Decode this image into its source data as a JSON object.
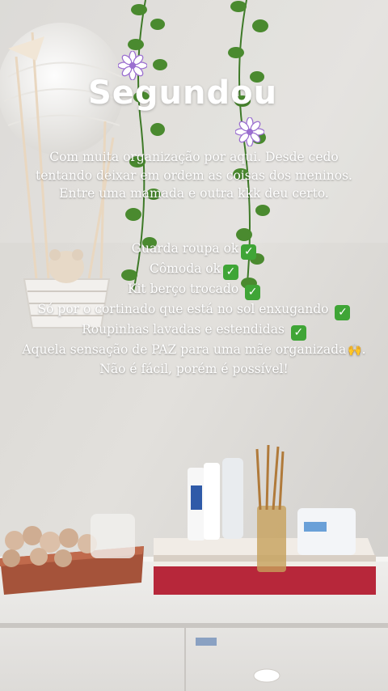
{
  "story": {
    "title": "Segundou",
    "intro_lines": [
      "Com muita organização por aqui. Desde cedo",
      "tentando deixar em ordem as coisas dos meninos.",
      "Entre uma mamada e outra kkk deu certo."
    ],
    "checklist": [
      {
        "text": "Guarda roupa ok",
        "icon": "check-mark-icon"
      },
      {
        "text": "Cômoda ok",
        "icon": "check-mark-icon"
      },
      {
        "text": "Kit berço trocado ",
        "icon": "check-mark-icon"
      },
      {
        "text": "Só por o cortinado que está no sol enxugando ",
        "icon": "check-mark-icon"
      },
      {
        "text": "Roupinhas lavadas e estendidas ",
        "icon": "check-mark-icon"
      },
      {
        "text": "Aquela sensação de PAZ para uma mãe organizada",
        "icon": "raised-hands-icon",
        "suffix": "."
      }
    ],
    "closing": "Não é fácil, porém é possível!",
    "check_glyph": "✓",
    "hands_glyph": "🙌",
    "flower_color": "#9b6fd0",
    "check_color": "#3fa536"
  }
}
